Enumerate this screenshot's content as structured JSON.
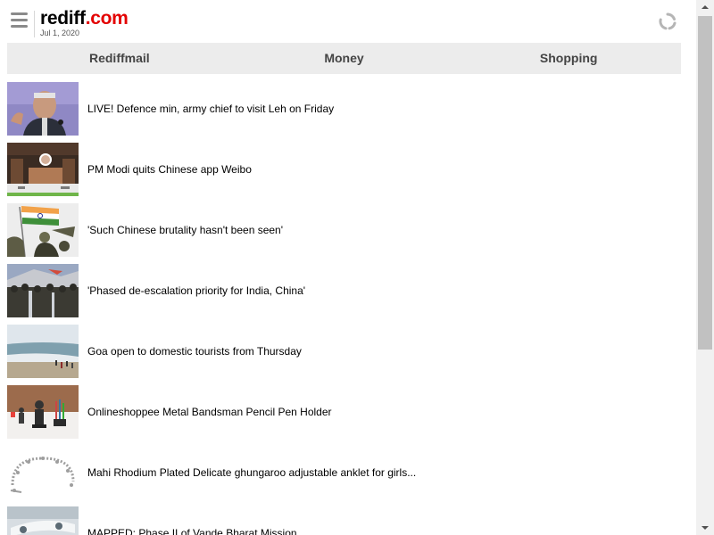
{
  "header": {
    "logo": {
      "name": "rediff",
      "dot": ".",
      "tld": "com"
    },
    "date": "Jul 1, 2020"
  },
  "nav": {
    "items": [
      {
        "label": "Rediffmail"
      },
      {
        "label": "Money"
      },
      {
        "label": "Shopping"
      }
    ]
  },
  "stories": [
    {
      "title": "LIVE! Defence min, army chief to visit Leh on Friday",
      "thumb_icon": "minister-speaking-photo"
    },
    {
      "title": "PM Modi quits Chinese app Weibo",
      "thumb_icon": "pm-modi-screenshot"
    },
    {
      "title": "'Such Chinese brutality hasn't been seen'",
      "thumb_icon": "indian-flag-soldiers-photo"
    },
    {
      "title": "'Phased de-escalation priority for India, China'",
      "thumb_icon": "army-parade-photo"
    },
    {
      "title": "Goa open to domestic tourists from Thursday",
      "thumb_icon": "goa-beach-photo"
    },
    {
      "title": "Onlineshoppee Metal Bandsman Pencil Pen Holder",
      "thumb_icon": "pen-holder-product-photo"
    },
    {
      "title": "Mahi Rhodium Plated Delicate ghungaroo adjustable anklet for girls...",
      "thumb_icon": "anklet-product-photo"
    },
    {
      "title": "MAPPED: Phase II of Vande Bharat Mission",
      "thumb_icon": "airplane-photo"
    }
  ],
  "colors": {
    "brand_red": "#e30000",
    "nav_background": "#ececec",
    "nav_text": "#444444"
  }
}
